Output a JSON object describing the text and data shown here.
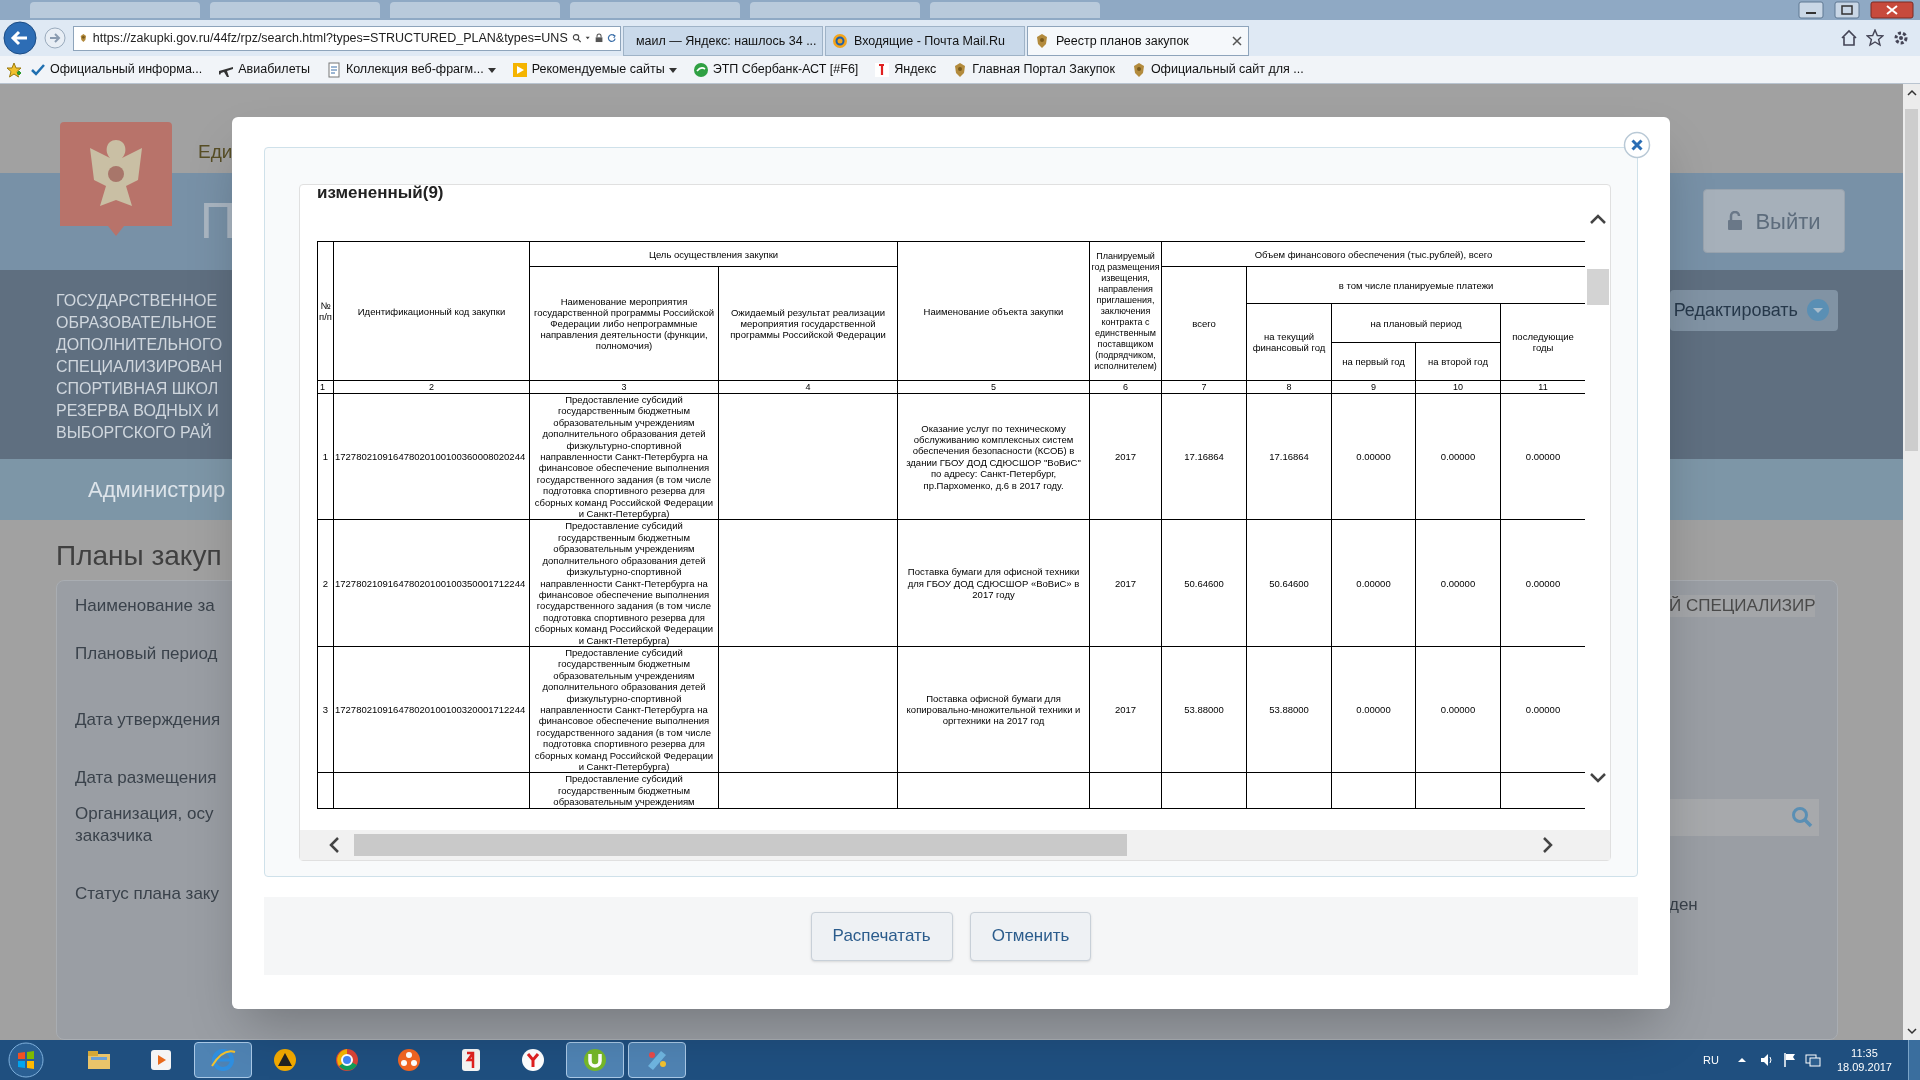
{
  "browser": {
    "url": "https://zakupki.gov.ru/44fz/rpz/search.html?types=STRUCTURED_PLAN&types=UNS",
    "tabs": [
      {
        "label": "маил — Яндекс: нашлось 34 ...",
        "selected": false
      },
      {
        "label": "Входящие - Почта Mail.Ru",
        "selected": false
      },
      {
        "label": "Реестр планов закупок",
        "selected": true
      }
    ],
    "bookmarks": [
      {
        "label": "Официальный информа...",
        "dropdown": false
      },
      {
        "label": "Авиабилеты",
        "dropdown": false
      },
      {
        "label": "Коллекция веб-фрагм...",
        "dropdown": true
      },
      {
        "label": "Рекомендуемые сайты",
        "dropdown": true
      },
      {
        "label": "ЭТП Сбербанк-АСТ [#F6]",
        "dropdown": false
      },
      {
        "label": "Яндекс",
        "dropdown": false
      },
      {
        "label": "Главная Портал Закупок",
        "dropdown": false
      },
      {
        "label": "Официальный сайт для ...",
        "dropdown": false
      }
    ]
  },
  "page": {
    "site_word": "Еди",
    "title_letter": "П",
    "logout": "Выйти",
    "org_lines": [
      "ГОСУДАРСТВЕННОЕ",
      "ОБРАЗОВАТЕЛЬНОЕ",
      "ДОПОЛНИТЕЛЬНОГО",
      "СПЕЦИАЛИЗИРОВАН",
      "СПОРТИВНАЯ ШКОЛ",
      "РЕЗЕРВА ВОДНЫХ И",
      "ВЫБОРГСКОГО РАЙ"
    ],
    "edit": "Редактировать",
    "nav": "Администрир",
    "heading": "Планы закуп",
    "fields": [
      {
        "lines": [
          "Наименование за"
        ]
      },
      {
        "lines": [
          "Плановый период"
        ]
      },
      {
        "lines": [
          "Дата утверждения"
        ]
      },
      {
        "lines": [
          "Дата размещения"
        ]
      },
      {
        "lines": [
          "Организация, осу",
          "заказчика"
        ]
      },
      {
        "lines": [
          "Статус плана заку"
        ]
      }
    ],
    "name_value": "Й СПЕЦИАЛИЗИР",
    "status_value": "ден"
  },
  "dialog": {
    "heading": "измененный(9)",
    "table": {
      "header": {
        "number": "№ п/п",
        "code": "Идентификационный код закупки",
        "goal": "Цель осуществления закупки",
        "event": "Наименование мероприятия государственной программы Российской Федерации либо непрограммные направления деятельности (функции, полномочия)",
        "result": "Ожидаемый результат реализации мероприятия государственной программы Российской Федерации",
        "object": "Наименование объекта закупки",
        "year": "Планируемый год размещения извещения, направления приглашения, заключения контракта с единственным поставщиком (подрядчиком, исполнителем)",
        "finance": "Объем финансового обеспечения (тыс.рублей), всего",
        "total": "всего",
        "planned": "в том числе планируемые платежи",
        "current": "на текущий финансовый год",
        "period": "на плановый период",
        "first": "на первый год",
        "second": "на второй год",
        "later": "последующие годы"
      },
      "column_numbers": [
        "1",
        "2",
        "3",
        "4",
        "5",
        "6",
        "7",
        "8",
        "9",
        "10",
        "11"
      ],
      "rows": [
        {
          "number": "1",
          "code": "172780210916478020100100360008020244",
          "event": "Предоставление субсидий государственным бюджетным образовательным учреждениям дополнительного образования детей физкультурно-спортивной направленности Санкт-Петербурга на финансовое обеспечение выполнения государственного задания (в том числе подготовка спортивного резерва для сборных команд Российской Федерации и Санкт-Петербурга)",
          "object": "Оказание услуг по техническому обслуживанию комплексных систем обеспечения безопасности (КСОБ) в здании ГБОУ ДОД СДЮСШОР \"ВоВиС\" по адресу: Санкт-Петербург, пр.Пархоменко, д.6 в 2017 году.",
          "year": "2017",
          "total": "17.16864",
          "current": "17.16864",
          "first": "0.00000",
          "second": "0.00000",
          "later": "0.00000"
        },
        {
          "number": "2",
          "code": "172780210916478020100100350001712244",
          "event": "Предоставление субсидий государственным бюджетным образовательным учреждениям дополнительного образования детей физкультурно-спортивной направленности Санкт-Петербурга на финансовое обеспечение выполнения государственного задания (в том числе подготовка спортивного резерва для сборных команд Российской Федерации и Санкт-Петербурга)",
          "object": "Поставка бумаги для офисной техники для ГБОУ ДОД СДЮСШОР «ВоВиС» в 2017 году",
          "year": "2017",
          "total": "50.64600",
          "current": "50.64600",
          "first": "0.00000",
          "second": "0.00000",
          "later": "0.00000"
        },
        {
          "number": "3",
          "code": "172780210916478020100100320001712244",
          "event": "Предоставление субсидий государственным бюджетным образовательным учреждениям дополнительного образования детей физкультурно-спортивной направленности Санкт-Петербурга на финансовое обеспечение выполнения государственного задания (в том числе подготовка спортивного резерва для сборных команд Российской Федерации и Санкт-Петербурга)",
          "object": "Поставка офисной бумаги для копировально-множительной техники и оргтехники на 2017 год",
          "year": "2017",
          "total": "53.88000",
          "current": "53.88000",
          "first": "0.00000",
          "second": "0.00000",
          "later": "0.00000"
        },
        {
          "event": "Предоставление субсидий государственным бюджетным образовательным учреждениям"
        }
      ]
    },
    "buttons": [
      {
        "label": "Распечатать"
      },
      {
        "label": "Отменить"
      }
    ]
  },
  "taskbar": {
    "apps": [
      {
        "active": false
      },
      {
        "active": false
      },
      {
        "active": true
      },
      {
        "active": false
      },
      {
        "active": false
      },
      {
        "active": false
      },
      {
        "active": false
      },
      {
        "active": false
      },
      {
        "active": true
      },
      {
        "active": true
      }
    ],
    "language": "RU",
    "time": "11:35",
    "date": "18.09.2017"
  }
}
